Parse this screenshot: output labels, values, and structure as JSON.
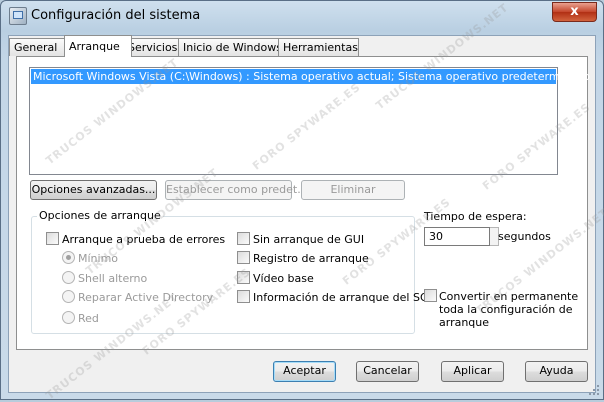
{
  "window": {
    "title": "Configuración del sistema",
    "close_label": "x"
  },
  "tabs": [
    {
      "label": "General",
      "active": false
    },
    {
      "label": "Arranque",
      "active": true
    },
    {
      "label": "Servicios",
      "active": false
    },
    {
      "label": "Inicio de Windows",
      "active": false
    },
    {
      "label": "Herramientas",
      "active": false
    }
  ],
  "os_list": {
    "items": [
      "Microsoft Windows Vista (C:\\Windows) : Sistema operativo actual; Sistema operativo predeterminado"
    ],
    "selected_index": 0
  },
  "buttons": {
    "advanced": "Opciones avanzadas...",
    "set_default": "Establecer como predet.",
    "delete": "Eliminar"
  },
  "boot_options": {
    "group_label": "Opciones de arranque",
    "safe_boot": {
      "label": "Arranque a prueba de errores",
      "checked": false
    },
    "radios": [
      {
        "label": "Mínimo",
        "checked": true,
        "enabled": false
      },
      {
        "label": "Shell alterno",
        "checked": false,
        "enabled": false
      },
      {
        "label": "Reparar Active Directory",
        "checked": false,
        "enabled": false
      },
      {
        "label": "Red",
        "checked": false,
        "enabled": false
      }
    ],
    "no_gui": {
      "label": "Sin arranque de GUI",
      "checked": false
    },
    "boot_log": {
      "label": "Registro de arranque",
      "checked": false
    },
    "base_video": {
      "label": "Vídeo base",
      "checked": false
    },
    "os_boot_info": {
      "label": "Información de arranque del SO",
      "checked": false
    }
  },
  "timeout": {
    "label": "Tiempo de espera:",
    "value": "30",
    "unit": "segundos"
  },
  "make_permanent": {
    "label_lines": [
      "Convertir en permanente",
      "toda la configuración de",
      "arranque"
    ],
    "checked": false
  },
  "footer": {
    "ok": "Aceptar",
    "cancel": "Cancelar",
    "apply": "Aplicar",
    "help": "Ayuda"
  },
  "watermark": {
    "texts": [
      "TRUCOS WINDOWS.NET",
      "FORO SPYWARE.ES"
    ]
  }
}
